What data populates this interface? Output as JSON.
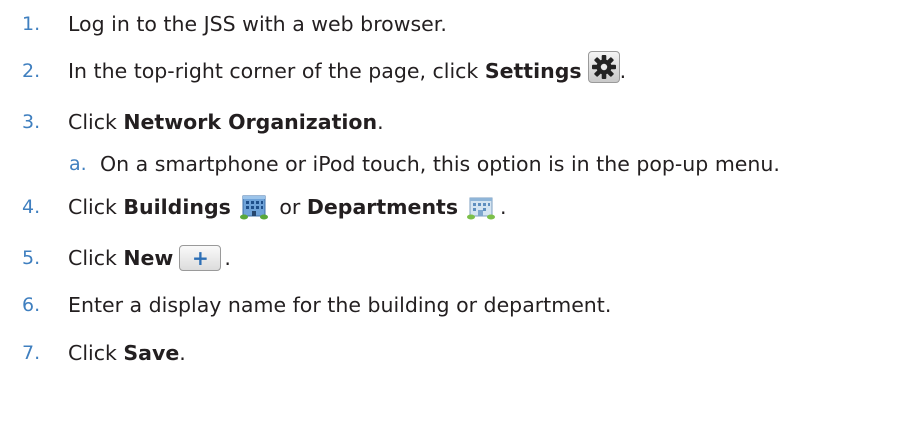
{
  "steps": [
    {
      "num": "1.",
      "text": "Log in to the JSS with a web browser."
    },
    {
      "num": "2.",
      "pre": "In the top-right corner of the page, click ",
      "bold": "Settings",
      "post": "."
    },
    {
      "num": "3.",
      "pre": "Click ",
      "bold": "Network Organization",
      "post": "."
    },
    {
      "num": "a.",
      "text": "On a smartphone or iPod touch, this option is in the pop-up menu."
    },
    {
      "num": "4.",
      "pre": "Click ",
      "bold": "Buildings",
      "mid": " or ",
      "bold2": "Departments",
      "post": "."
    },
    {
      "num": "5.",
      "pre": "Click ",
      "bold": "New",
      "post": "."
    },
    {
      "num": "6.",
      "text": "Enter a display name for the building or department."
    },
    {
      "num": "7.",
      "pre": "Click ",
      "bold": "Save",
      "post": "."
    }
  ],
  "icons": {
    "settings": "gear-icon",
    "buildings": "building-icon",
    "departments": "departments-icon",
    "new": "plus-icon",
    "new_symbol": "+"
  }
}
